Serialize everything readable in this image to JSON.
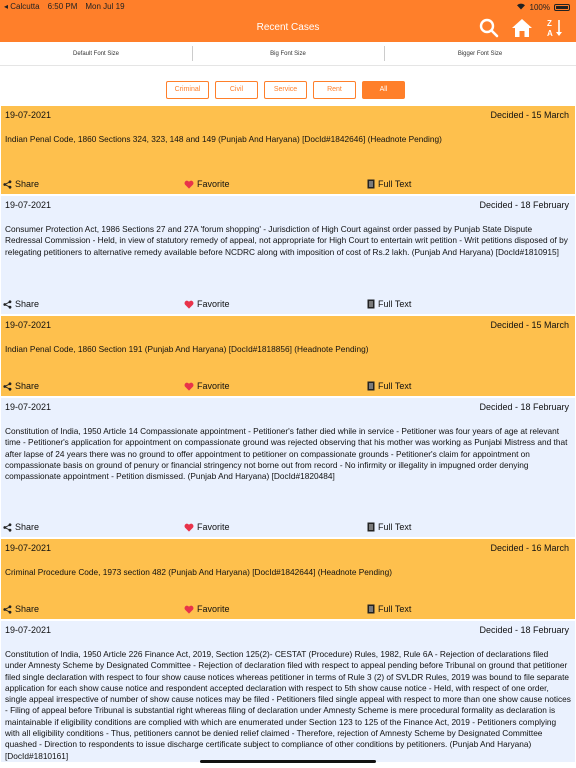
{
  "statusbar": {
    "back_app": "◂ Calcutta",
    "time": "6:50 PM",
    "date": "Mon Jul 19",
    "battery": "100%"
  },
  "navbar": {
    "title": "Recent Cases"
  },
  "font_sizes": [
    "Default Font Size",
    "Big Font Size",
    "Bigger Font Size"
  ],
  "filters": [
    {
      "label": "Criminal",
      "active": false
    },
    {
      "label": "Civil",
      "active": false
    },
    {
      "label": "Service",
      "active": false
    },
    {
      "label": "Rent",
      "active": false
    },
    {
      "label": "All",
      "active": true
    }
  ],
  "actions": {
    "share": "Share",
    "favorite": "Favorite",
    "full_text": "Full Text"
  },
  "colors": {
    "accent": "#ff7f2a",
    "orange_card": "#fec04d",
    "blue_card": "#eaf1fe",
    "heart": "#e8334a"
  },
  "cases": [
    {
      "date": "19-07-2021",
      "status": "Decided - 15 March",
      "text": "Indian Penal Code, 1860 Sections 324, 323, 148 and 149 (Punjab And Haryana) [DocId#1842646] (Headnote Pending)"
    },
    {
      "date": "19-07-2021",
      "status": "Decided - 18 February",
      "text": "Consumer Protection Act, 1986 Sections 27 and 27A 'forum shopping' - Jurisdiction of High Court against order passed by Punjab State Dispute Redressal Commission - Held, in view of statutory remedy of appeal, not appropriate for High Court to entertain writ petition - Writ petitions disposed of by relegating petitioners to alternative remedy available before NCDRC along with imposition of cost of Rs.2 lakh. (Punjab And Haryana) [DocId#1810915]"
    },
    {
      "date": "19-07-2021",
      "status": "Decided - 15 March",
      "text": "Indian Penal Code, 1860 Section 191 (Punjab And Haryana) [DocId#1818856] (Headnote Pending)"
    },
    {
      "date": "19-07-2021",
      "status": "Decided - 18 February",
      "text": "Constitution of India, 1950 Article 14 Compassionate appointment - Petitioner's father died while in service - Petitioner was four years of age at relevant time - Petitioner's application for appointment on compassionate ground was rejected observing that his mother was working as Punjabi Mistress and that after lapse of 24 years there was no ground to offer appointment to petitioner on compassionate grounds - Petitioner's claim for appointment on compassionate basis on ground of penury or financial stringency not borne out from record - No infirmity or illegality in impugned order denying compassionate appointment - Petition dismissed. (Punjab And Haryana) [DocId#1820484]"
    },
    {
      "date": "19-07-2021",
      "status": "Decided - 16 March",
      "text": "Criminal Procedure Code, 1973 section 482 (Punjab And Haryana) [DocId#1842644] (Headnote Pending)"
    },
    {
      "date": "19-07-2021",
      "status": "Decided - 18 February",
      "text": "Constitution of India, 1950 Article 226 Finance Act, 2019, Section 125(2)- CESTAT (Procedure) Rules, 1982, Rule 6A - Rejection of declarations filed under Amnesty Scheme by Designated Committee - Rejection of declaration filed with respect to appeal pending before Tribunal on ground that petitioner filed single declaration with respect to four show cause notices whereas petitioner in terms of Rule 3 (2) of SVLDR Rules, 2019 was bound to file separate application for each show cause notice and respondent accepted declaration with respect to 5th show cause notice - Held, with respect of one order, single appeal irrespective of number of show cause notices may be filed - Petitioners filed single appeal with respect to more than one show cause notices - Filing of appeal before Tribunal is substantial right whereas filing of declaration under Amnesty Scheme is mere procedural formality as declaration is maintainable if eligibility conditions are complied with which are enumerated under Section 123 to 125 of the Finance Act, 2019 - Petitioners complying with all eligibility conditions - Thus, petitioners cannot be denied relief claimed - Therefore, rejection of Amnesty Scheme by Designated Committee quashed - Direction to respondents to issue discharge certificate subject to compliance of other conditions by petitioners. (Punjab And Haryana) [DocId#1810161]"
    }
  ]
}
